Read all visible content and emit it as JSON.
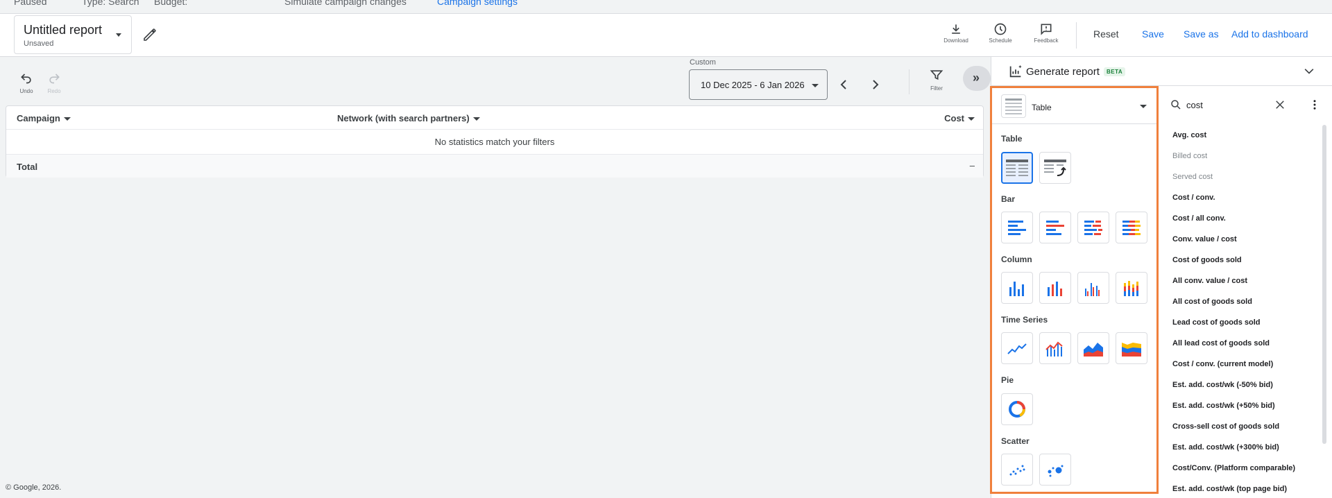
{
  "top_strip": {
    "items": [
      "Paused",
      "Type: Search",
      "Budget: ",
      "Simulate campaign changes",
      "Campaign settings"
    ]
  },
  "report": {
    "title": "Untitled report",
    "status": "Unsaved"
  },
  "toolbar": {
    "download_label": "Download",
    "schedule_label": "Schedule",
    "feedback_label": "Feedback",
    "reset_label": "Reset",
    "save_label": "Save",
    "save_as_label": "Save as",
    "add_dashboard_label": "Add to dashboard"
  },
  "controls": {
    "undo_label": "Undo",
    "redo_label": "Redo",
    "date_range_caption": "Custom",
    "date_range_value": "10 Dec 2025 - 6 Jan 2026",
    "filter_label": "Filter"
  },
  "table": {
    "columns": [
      "Campaign",
      "Network (with search partners)",
      "Cost"
    ],
    "empty_message": "No statistics match your filters",
    "total_label": "Total",
    "total_value": "–"
  },
  "footer": "© Google, 2026.",
  "panel": {
    "generate_label": "Generate report",
    "beta_badge": "BETA",
    "viz_selected": "Table",
    "sections": [
      "Table",
      "Bar",
      "Column",
      "Time Series",
      "Pie",
      "Scatter"
    ],
    "search_value": "cost",
    "metrics": [
      {
        "pre": "Avg. ",
        "hl": "cost",
        "post": "",
        "disabled": false
      },
      {
        "pre": "Billed cost",
        "hl": "",
        "post": "",
        "disabled": true
      },
      {
        "pre": "Served cost",
        "hl": "",
        "post": "",
        "disabled": true
      },
      {
        "pre": "",
        "hl": "Cost",
        "post": " / conv.",
        "disabled": false
      },
      {
        "pre": "",
        "hl": "Cost",
        "post": " / all conv.",
        "disabled": false
      },
      {
        "pre": "Conv. value / ",
        "hl": "cost",
        "post": "",
        "disabled": false
      },
      {
        "pre": "",
        "hl": "Cost",
        "post": " of goods sold",
        "disabled": false
      },
      {
        "pre": "All conv. value / ",
        "hl": "cost",
        "post": "",
        "disabled": false
      },
      {
        "pre": "All ",
        "hl": "cost",
        "post": " of goods sold",
        "disabled": false
      },
      {
        "pre": "Lead ",
        "hl": "cost",
        "post": " of goods sold",
        "disabled": false
      },
      {
        "pre": "All lead ",
        "hl": "cost",
        "post": " of goods sold",
        "disabled": false
      },
      {
        "pre": "",
        "hl": "Cost",
        "post": " / conv. (current model)",
        "disabled": false
      },
      {
        "pre": "Est. add. ",
        "hl": "cost",
        "post": "/wk (-50% bid)",
        "disabled": false
      },
      {
        "pre": "Est. add. ",
        "hl": "cost",
        "post": "/wk (+50% bid)",
        "disabled": false
      },
      {
        "pre": "Cross-sell ",
        "hl": "cost",
        "post": " of goods sold",
        "disabled": false
      },
      {
        "pre": "Est. add. ",
        "hl": "cost",
        "post": "/wk (+300% bid)",
        "disabled": false
      },
      {
        "pre": "",
        "hl": "Cost",
        "post": "/Conv. (Platform comparable)",
        "disabled": false
      },
      {
        "pre": "Est. add. ",
        "hl": "cost",
        "post": "/wk (top page bid)",
        "disabled": false
      }
    ]
  },
  "colors": {
    "accent": "#1a73e8",
    "highlight_border": "#f0803c",
    "red": "#ea4335",
    "yellow": "#fbbc04"
  }
}
